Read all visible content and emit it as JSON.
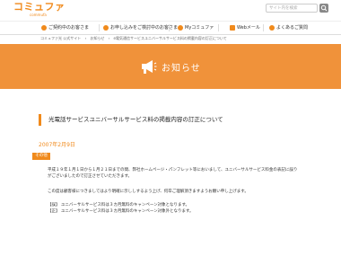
{
  "header": {
    "logo_main": "コミュファ",
    "logo_sub": "commufa",
    "search_placeholder": "サイト内を検索"
  },
  "nav": {
    "items": [
      {
        "label": "ご契約中のお客さま"
      },
      {
        "label": "お申し込みをご検討中のお客さま"
      },
      {
        "label": "Myコミュファ"
      },
      {
        "label": "Webメール"
      },
      {
        "label": "よくあるご質問"
      }
    ]
  },
  "breadcrumb": [
    "コミュファ光 公式サイト",
    "お知らせ",
    "e電気通信サービスユニバーサルサービス料の掲載内容の訂正について"
  ],
  "banner": {
    "title": "お知らせ"
  },
  "article": {
    "title": "光電話サービスユニバーサルサービス料の掲載内容の訂正について",
    "date": "2007年2月9日",
    "badge": "その他",
    "para1_line1": "平成１９年１月１日から１月２１日までの間、弊社ホームページ・パンフレット等においまして、ユニバーサルサービス料金の表記に誤り",
    "para1_line2": "がございましたので訂正させていただきます。",
    "para2": "この度は顧客様につきましてはより明確に示ししするよう上げ、何卒ご理解頂きますようお願い申し上げます。",
    "item1": "【誤】 ユニバーサルサービス料は３カ月無料のキャンペーン対象となります。",
    "item2": "【正】 ユニバーサルサービス料は３カ月無料のキャンペーン対象外となります。"
  },
  "colors": {
    "accent": "#f08a1c",
    "banner": "#f0923a"
  }
}
